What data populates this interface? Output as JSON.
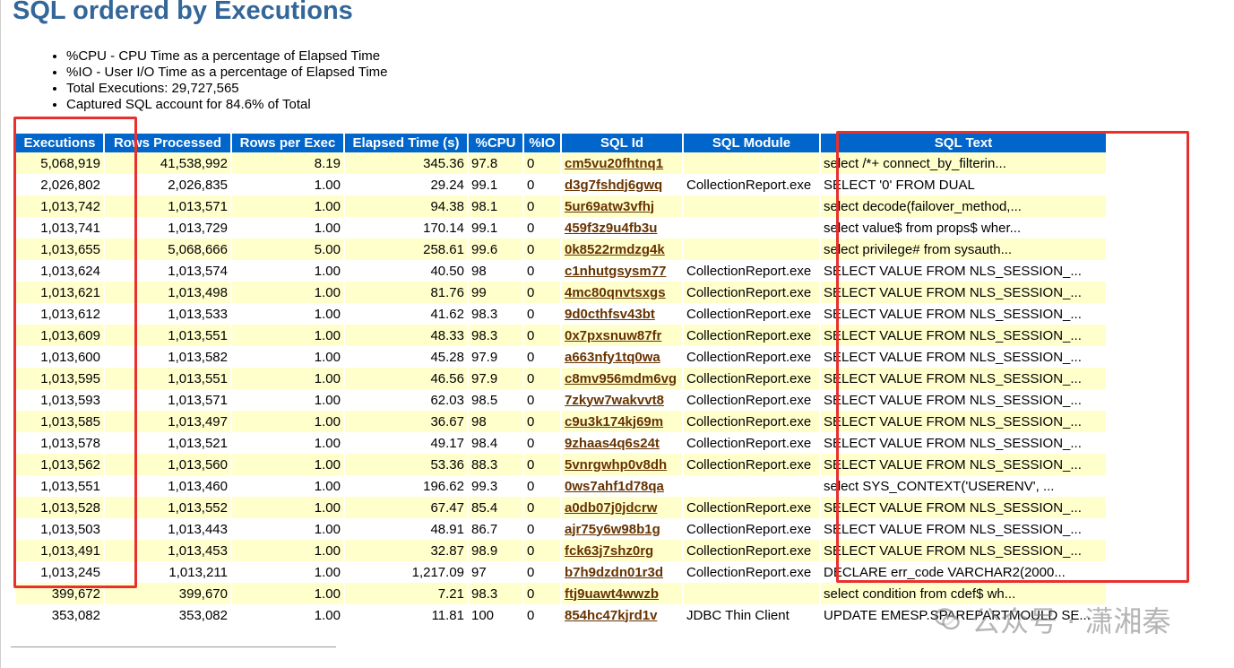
{
  "page": {
    "title": "SQL ordered by Executions",
    "notes": [
      "%CPU - CPU Time as a percentage of Elapsed Time",
      "%IO - User I/O Time as a percentage of Elapsed Time",
      "Total Executions: 29,727,565",
      "Captured SQL account for 84.6% of Total"
    ]
  },
  "table": {
    "headers": {
      "executions": "Executions",
      "rows_processed": "Rows Processed",
      "rows_per_exec": "Rows per Exec",
      "elapsed_time": "Elapsed Time (s)",
      "cpu": "%CPU",
      "io": "%IO",
      "sql_id": "SQL Id",
      "sql_module": "SQL Module",
      "sql_text": "SQL Text"
    },
    "rows": [
      {
        "executions": "5,068,919",
        "rows_processed": "41,538,992",
        "rows_per_exec": "8.19",
        "elapsed_time": "345.36",
        "cpu": "97.8",
        "io": "0",
        "sql_id": "cm5vu20fhtnq1",
        "sql_module": "",
        "sql_text": "select /*+ connect_by_filterin..."
      },
      {
        "executions": "2,026,802",
        "rows_processed": "2,026,835",
        "rows_per_exec": "1.00",
        "elapsed_time": "29.24",
        "cpu": "99.1",
        "io": "0",
        "sql_id": "d3g7fshdj6gwq",
        "sql_module": "CollectionReport.exe",
        "sql_text": "SELECT '0' FROM DUAL"
      },
      {
        "executions": "1,013,742",
        "rows_processed": "1,013,571",
        "rows_per_exec": "1.00",
        "elapsed_time": "94.38",
        "cpu": "98.1",
        "io": "0",
        "sql_id": "5ur69atw3vfhj",
        "sql_module": "",
        "sql_text": "select decode(failover_method,..."
      },
      {
        "executions": "1,013,741",
        "rows_processed": "1,013,729",
        "rows_per_exec": "1.00",
        "elapsed_time": "170.14",
        "cpu": "99.1",
        "io": "0",
        "sql_id": "459f3z9u4fb3u",
        "sql_module": "",
        "sql_text": "select value$ from props$ wher..."
      },
      {
        "executions": "1,013,655",
        "rows_processed": "5,068,666",
        "rows_per_exec": "5.00",
        "elapsed_time": "258.61",
        "cpu": "99.6",
        "io": "0",
        "sql_id": "0k8522rmdzg4k",
        "sql_module": "",
        "sql_text": "select privilege# from sysauth..."
      },
      {
        "executions": "1,013,624",
        "rows_processed": "1,013,574",
        "rows_per_exec": "1.00",
        "elapsed_time": "40.50",
        "cpu": "98",
        "io": "0",
        "sql_id": "c1nhutgsysm77",
        "sql_module": "CollectionReport.exe",
        "sql_text": "SELECT VALUE FROM NLS_SESSION_..."
      },
      {
        "executions": "1,013,621",
        "rows_processed": "1,013,498",
        "rows_per_exec": "1.00",
        "elapsed_time": "81.76",
        "cpu": "99",
        "io": "0",
        "sql_id": "4mc80qnvtsxgs",
        "sql_module": "CollectionReport.exe",
        "sql_text": "SELECT VALUE FROM NLS_SESSION_..."
      },
      {
        "executions": "1,013,612",
        "rows_processed": "1,013,533",
        "rows_per_exec": "1.00",
        "elapsed_time": "41.62",
        "cpu": "98.3",
        "io": "0",
        "sql_id": "9d0cthfsv43bt",
        "sql_module": "CollectionReport.exe",
        "sql_text": "SELECT VALUE FROM NLS_SESSION_..."
      },
      {
        "executions": "1,013,609",
        "rows_processed": "1,013,551",
        "rows_per_exec": "1.00",
        "elapsed_time": "48.33",
        "cpu": "98.3",
        "io": "0",
        "sql_id": "0x7pxsnuw87fr",
        "sql_module": "CollectionReport.exe",
        "sql_text": "SELECT VALUE FROM NLS_SESSION_..."
      },
      {
        "executions": "1,013,600",
        "rows_processed": "1,013,582",
        "rows_per_exec": "1.00",
        "elapsed_time": "45.28",
        "cpu": "97.9",
        "io": "0",
        "sql_id": "a663nfy1tq0wa",
        "sql_module": "CollectionReport.exe",
        "sql_text": "SELECT VALUE FROM NLS_SESSION_..."
      },
      {
        "executions": "1,013,595",
        "rows_processed": "1,013,551",
        "rows_per_exec": "1.00",
        "elapsed_time": "46.56",
        "cpu": "97.9",
        "io": "0",
        "sql_id": "c8mv956mdm6vg",
        "sql_module": "CollectionReport.exe",
        "sql_text": "SELECT VALUE FROM NLS_SESSION_..."
      },
      {
        "executions": "1,013,593",
        "rows_processed": "1,013,571",
        "rows_per_exec": "1.00",
        "elapsed_time": "62.03",
        "cpu": "98.5",
        "io": "0",
        "sql_id": "7zkyw7wakvvt8",
        "sql_module": "CollectionReport.exe",
        "sql_text": "SELECT VALUE FROM NLS_SESSION_..."
      },
      {
        "executions": "1,013,585",
        "rows_processed": "1,013,497",
        "rows_per_exec": "1.00",
        "elapsed_time": "36.67",
        "cpu": "98",
        "io": "0",
        "sql_id": "c9u3k174kj69m",
        "sql_module": "CollectionReport.exe",
        "sql_text": "SELECT VALUE FROM NLS_SESSION_..."
      },
      {
        "executions": "1,013,578",
        "rows_processed": "1,013,521",
        "rows_per_exec": "1.00",
        "elapsed_time": "49.17",
        "cpu": "98.4",
        "io": "0",
        "sql_id": "9zhaas4q6s24t",
        "sql_module": "CollectionReport.exe",
        "sql_text": "SELECT VALUE FROM NLS_SESSION_..."
      },
      {
        "executions": "1,013,562",
        "rows_processed": "1,013,560",
        "rows_per_exec": "1.00",
        "elapsed_time": "53.36",
        "cpu": "88.3",
        "io": "0",
        "sql_id": "5vnrgwhp0v8dh",
        "sql_module": "CollectionReport.exe",
        "sql_text": "SELECT VALUE FROM NLS_SESSION_..."
      },
      {
        "executions": "1,013,551",
        "rows_processed": "1,013,460",
        "rows_per_exec": "1.00",
        "elapsed_time": "196.62",
        "cpu": "99.3",
        "io": "0",
        "sql_id": "0ws7ahf1d78qa",
        "sql_module": "",
        "sql_text": "select SYS_CONTEXT('USERENV', ..."
      },
      {
        "executions": "1,013,528",
        "rows_processed": "1,013,552",
        "rows_per_exec": "1.00",
        "elapsed_time": "67.47",
        "cpu": "85.4",
        "io": "0",
        "sql_id": "a0db07j0jdcrw",
        "sql_module": "CollectionReport.exe",
        "sql_text": "SELECT VALUE FROM NLS_SESSION_..."
      },
      {
        "executions": "1,013,503",
        "rows_processed": "1,013,443",
        "rows_per_exec": "1.00",
        "elapsed_time": "48.91",
        "cpu": "86.7",
        "io": "0",
        "sql_id": "ajr75y6w98b1g",
        "sql_module": "CollectionReport.exe",
        "sql_text": "SELECT VALUE FROM NLS_SESSION_..."
      },
      {
        "executions": "1,013,491",
        "rows_processed": "1,013,453",
        "rows_per_exec": "1.00",
        "elapsed_time": "32.87",
        "cpu": "98.9",
        "io": "0",
        "sql_id": "fck63j7shz0rg",
        "sql_module": "CollectionReport.exe",
        "sql_text": "SELECT VALUE FROM NLS_SESSION_..."
      },
      {
        "executions": "1,013,245",
        "rows_processed": "1,013,211",
        "rows_per_exec": "1.00",
        "elapsed_time": "1,217.09",
        "cpu": "97",
        "io": "0",
        "sql_id": "b7h9dzdn01r3d",
        "sql_module": "CollectionReport.exe",
        "sql_text": "DECLARE err_code VARCHAR2(2000..."
      },
      {
        "executions": "399,672",
        "rows_processed": "399,670",
        "rows_per_exec": "1.00",
        "elapsed_time": "7.21",
        "cpu": "98.3",
        "io": "0",
        "sql_id": "ftj9uawt4wwzb",
        "sql_module": "",
        "sql_text": "select condition from cdef$ wh..."
      },
      {
        "executions": "353,082",
        "rows_processed": "353,082",
        "rows_per_exec": "1.00",
        "elapsed_time": "11.81",
        "cpu": "100",
        "io": "0",
        "sql_id": "854hc47kjrd1v",
        "sql_module": "JDBC Thin Client",
        "sql_text": "UPDATE EMESP.SPAREPARTMOULD SE..."
      }
    ]
  },
  "watermark": {
    "text": "公众号 · 潇湘秦",
    "icon": "wechat-icon"
  },
  "colors": {
    "title": "#336699",
    "header_bg": "#0066cc",
    "odd_row_bg": "#ffffcc",
    "sql_id_link": "#663300",
    "annotation_box": "#e8302f"
  }
}
